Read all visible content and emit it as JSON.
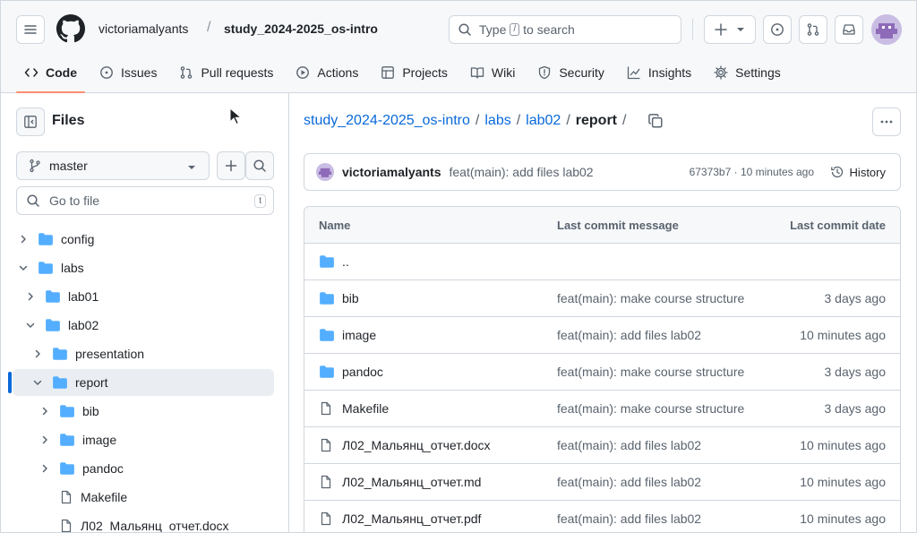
{
  "header": {
    "owner": "victoriamalyants",
    "separator": "/",
    "repo": "study_2024-2025_os-intro",
    "search_prefix": "Type",
    "search_key": "/",
    "search_suffix": "to search"
  },
  "tabs": [
    {
      "label": "Code",
      "icon": "code-icon"
    },
    {
      "label": "Issues",
      "icon": "issue-icon"
    },
    {
      "label": "Pull requests",
      "icon": "pull-request-icon"
    },
    {
      "label": "Actions",
      "icon": "play-icon"
    },
    {
      "label": "Projects",
      "icon": "table-icon"
    },
    {
      "label": "Wiki",
      "icon": "book-icon"
    },
    {
      "label": "Security",
      "icon": "shield-icon"
    },
    {
      "label": "Insights",
      "icon": "graph-icon"
    },
    {
      "label": "Settings",
      "icon": "gear-icon"
    }
  ],
  "sidebar": {
    "title": "Files",
    "branch": "master",
    "goto_placeholder": "Go to file",
    "goto_key": "t",
    "tree": [
      {
        "label": "config",
        "type": "folder",
        "depth": 0,
        "expanded": false,
        "selected": false
      },
      {
        "label": "labs",
        "type": "folder",
        "depth": 0,
        "expanded": true,
        "selected": false
      },
      {
        "label": "lab01",
        "type": "folder",
        "depth": 1,
        "expanded": false,
        "selected": false
      },
      {
        "label": "lab02",
        "type": "folder",
        "depth": 1,
        "expanded": true,
        "selected": false
      },
      {
        "label": "presentation",
        "type": "folder",
        "depth": 2,
        "expanded": false,
        "selected": false
      },
      {
        "label": "report",
        "type": "folder",
        "depth": 2,
        "expanded": true,
        "selected": true
      },
      {
        "label": "bib",
        "type": "folder",
        "depth": 3,
        "expanded": false,
        "selected": false
      },
      {
        "label": "image",
        "type": "folder",
        "depth": 3,
        "expanded": false,
        "selected": false
      },
      {
        "label": "pandoc",
        "type": "folder",
        "depth": 3,
        "expanded": false,
        "selected": false
      },
      {
        "label": "Makefile",
        "type": "file",
        "depth": 3,
        "expanded": false,
        "selected": false
      },
      {
        "label": "Л02_Мальянц_отчет.docx",
        "type": "file",
        "depth": 3,
        "expanded": false,
        "selected": false
      }
    ]
  },
  "breadcrumb": {
    "repo": "study_2024-2025_os-intro",
    "parts": [
      "labs",
      "lab02"
    ],
    "current": "report",
    "sep": "/"
  },
  "commit": {
    "author": "victoriamalyants",
    "message": "feat(main): add files lab02",
    "meta": "67373b7 · 10 minutes ago",
    "history_label": "History"
  },
  "table": {
    "columns": [
      "Name",
      "Last commit message",
      "Last commit date"
    ],
    "rows": [
      {
        "name": "..",
        "type": "folder",
        "msg": "",
        "date": ""
      },
      {
        "name": "bib",
        "type": "folder",
        "msg": "feat(main): make course structure",
        "date": "3 days ago"
      },
      {
        "name": "image",
        "type": "folder",
        "msg": "feat(main): add files lab02",
        "date": "10 minutes ago"
      },
      {
        "name": "pandoc",
        "type": "folder",
        "msg": "feat(main): make course structure",
        "date": "3 days ago"
      },
      {
        "name": "Makefile",
        "type": "file",
        "msg": "feat(main): make course structure",
        "date": "3 days ago"
      },
      {
        "name": "Л02_Мальянц_отчет.docx",
        "type": "file",
        "msg": "feat(main): add files lab02",
        "date": "10 minutes ago"
      },
      {
        "name": "Л02_Мальянц_отчет.md",
        "type": "file",
        "msg": "feat(main): add files lab02",
        "date": "10 minutes ago"
      },
      {
        "name": "Л02_Мальянц_отчет.pdf",
        "type": "file",
        "msg": "feat(main): add files lab02",
        "date": "10 minutes ago"
      }
    ]
  },
  "colors": {
    "accent": "#0969da",
    "folder": "#54aeff",
    "tab_underline": "#fd8c73"
  }
}
